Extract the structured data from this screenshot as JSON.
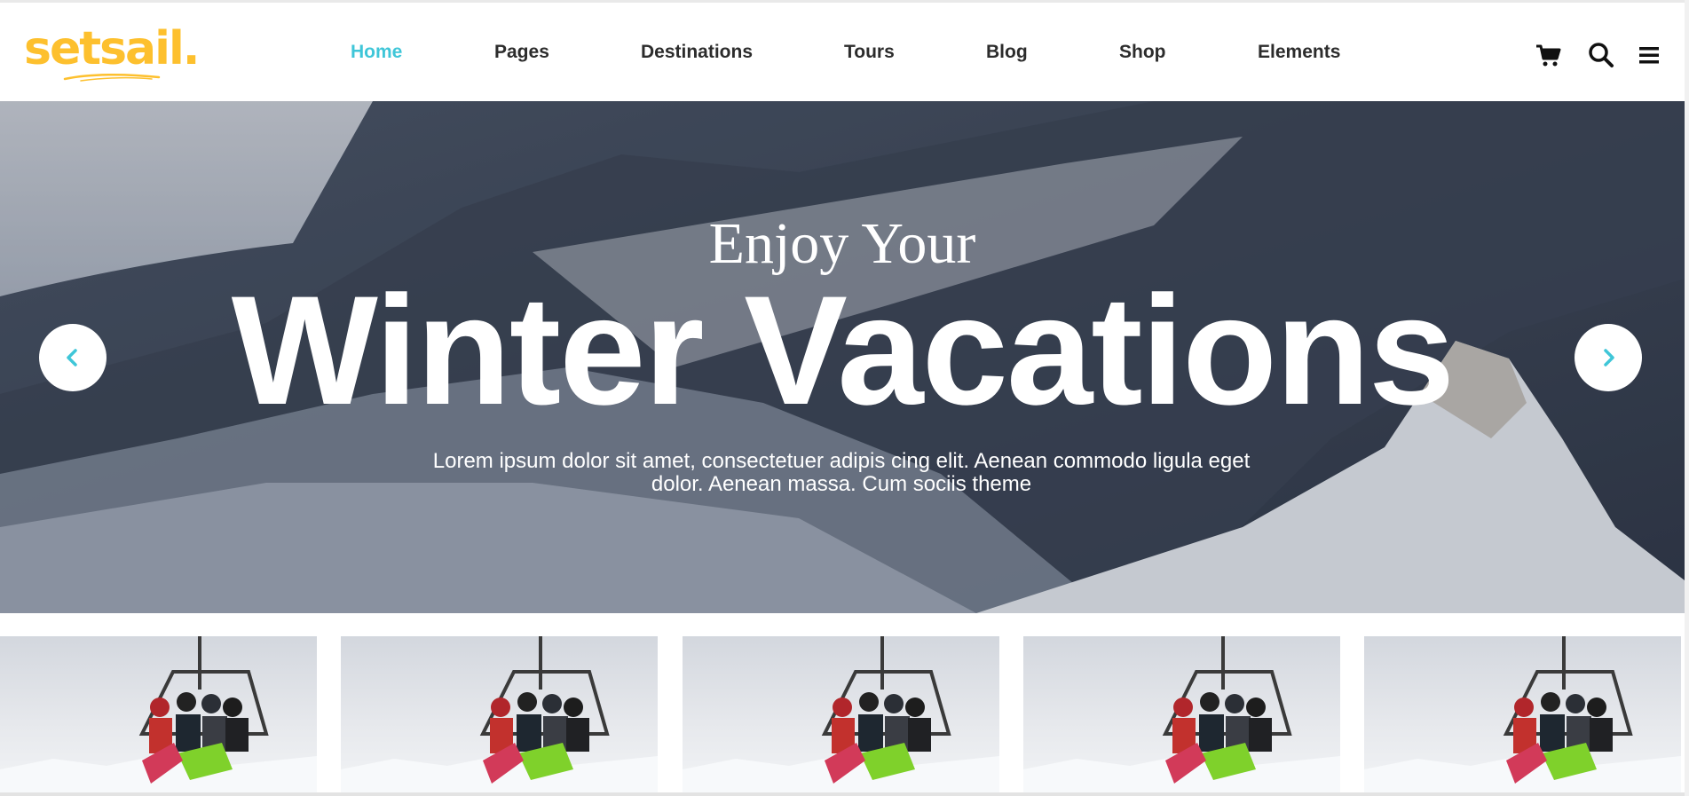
{
  "brand": {
    "logo_text": "setsail.",
    "logo_color": "#fdc02e",
    "accent_color": "#3fc6d8"
  },
  "nav": {
    "items": [
      {
        "label": "Home",
        "active": true
      },
      {
        "label": "Pages"
      },
      {
        "label": "Destinations"
      },
      {
        "label": "Tours"
      },
      {
        "label": "Blog"
      },
      {
        "label": "Shop"
      },
      {
        "label": "Elements"
      }
    ]
  },
  "header_icons": [
    "cart-icon",
    "search-icon",
    "menu-icon"
  ],
  "hero": {
    "pretitle": "Enjoy Your",
    "title": "Winter Vacations",
    "description_line1": "Lorem ipsum dolor sit amet, consectetuer adipis cing elit. Aenean commodo ligula eget",
    "description_line2": "dolor. Aenean massa. Cum sociis theme",
    "prev_icon": "chevron-left-icon",
    "next_icon": "chevron-right-icon"
  },
  "thumbnails": [
    {
      "image": "ski-lift-photo"
    },
    {
      "image": "ski-lift-photo"
    },
    {
      "image": "ski-lift-photo"
    },
    {
      "image": "ski-lift-photo"
    },
    {
      "image": "ski-lift-photo"
    }
  ]
}
